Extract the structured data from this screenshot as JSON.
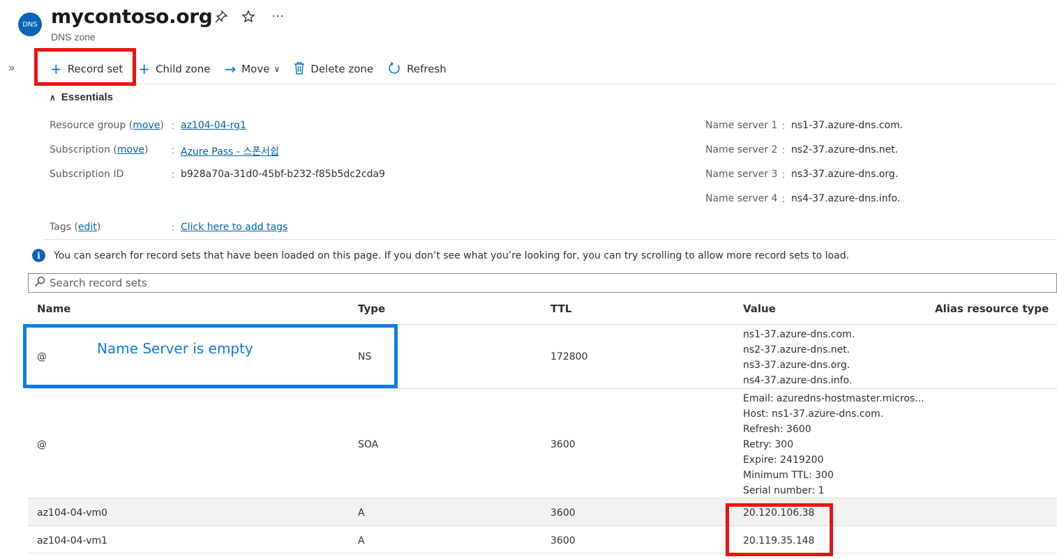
{
  "header": {
    "logo_text": "DNS",
    "title": "mycontoso.org",
    "subtitle": "DNS zone",
    "pin_icon": "pin-icon",
    "star_icon": "star-icon",
    "more_icon": "more-icon"
  },
  "toolbar": {
    "record_set": "Record set",
    "child_zone": "Child zone",
    "move": "Move",
    "delete_zone": "Delete zone",
    "refresh": "Refresh"
  },
  "essentials": {
    "heading": "Essentials",
    "resource_group_label": "Resource group",
    "resource_group_move": "move",
    "resource_group_value": "az104-04-rg1",
    "subscription_label": "Subscription",
    "subscription_move": "move",
    "subscription_value": "Azure Pass - 스폰서쉽",
    "subscription_id_label": "Subscription ID",
    "subscription_id_value": "b928a70a-31d0-45bf-b232-f85b5dc2cda9",
    "tags_label": "Tags",
    "tags_edit": "edit",
    "tags_value": "Click here to add tags",
    "name_servers": [
      {
        "label": "Name server 1",
        "value": "ns1-37.azure-dns.com."
      },
      {
        "label": "Name server 2",
        "value": "ns2-37.azure-dns.net."
      },
      {
        "label": "Name server 3",
        "value": "ns3-37.azure-dns.org."
      },
      {
        "label": "Name server 4",
        "value": "ns4-37.azure-dns.info."
      }
    ]
  },
  "info": {
    "message": "You can search for record sets that have been loaded on this page. If you don’t see what you’re looking for, you can try scrolling to allow more record sets to load."
  },
  "search": {
    "placeholder": "Search record sets"
  },
  "table": {
    "columns": [
      "Name",
      "Type",
      "TTL",
      "Value",
      "Alias resource type"
    ],
    "rows": [
      {
        "name": "@",
        "type": "NS",
        "ttl": "172800",
        "value": [
          "ns1-37.azure-dns.com.",
          "ns2-37.azure-dns.net.",
          "ns3-37.azure-dns.org.",
          "ns4-37.azure-dns.info."
        ]
      },
      {
        "name": "@",
        "type": "SOA",
        "ttl": "3600",
        "value": [
          "Email: azuredns-hostmaster.micros...",
          "Host: ns1-37.azure-dns.com.",
          "Refresh: 3600",
          "Retry: 300",
          "Expire: 2419200",
          "Minimum TTL: 300",
          "Serial number: 1"
        ]
      },
      {
        "name": "az104-04-vm0",
        "type": "A",
        "ttl": "3600",
        "value": [
          "20.120.106.38"
        ]
      },
      {
        "name": "az104-04-vm1",
        "type": "A",
        "ttl": "3600",
        "value": [
          "20.119.35.148"
        ]
      }
    ]
  },
  "annotation": {
    "text": "Name Server is empty",
    "highlight_red": "#ee1111",
    "highlight_blue": "#0f7bea"
  },
  "colors": {
    "accent": "#0078d4",
    "link": "#0062ad"
  }
}
